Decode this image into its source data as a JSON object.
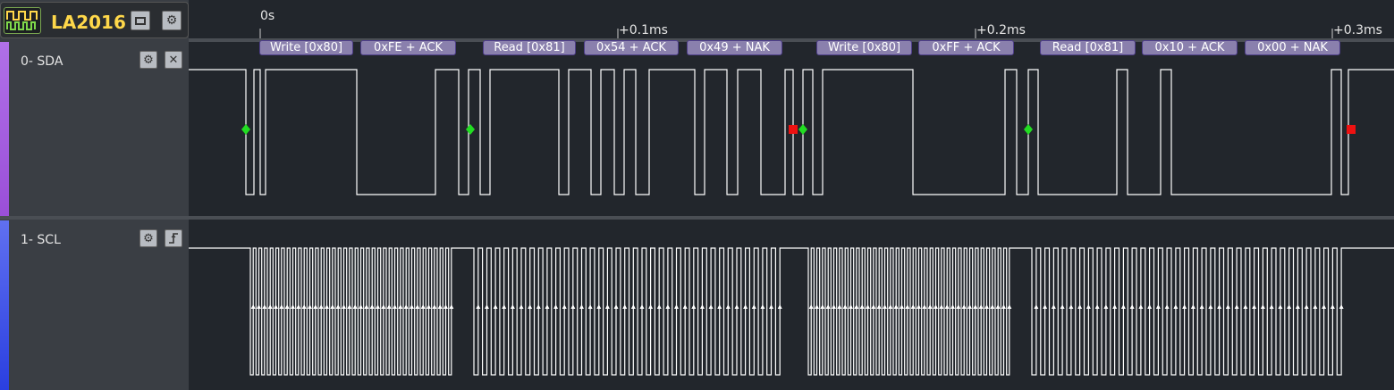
{
  "device": {
    "name": "LA2016",
    "logo_icon": "waveform-logo-icon"
  },
  "channels": [
    {
      "label": "0- SDA",
      "stripe_color": "#9a4fd8",
      "buttons": [
        "gear-icon",
        "close-icon"
      ]
    },
    {
      "label": "1- SCL",
      "stripe_color": "#2a3fe0",
      "buttons": [
        "gear-icon",
        "edge-trigger-icon"
      ]
    }
  ],
  "timeline": {
    "ticks": [
      "0s",
      "+0.1ms",
      "+0.2ms",
      "+0.3ms"
    ]
  },
  "annotations": [
    "Write [0x80]",
    "0xFE + ACK",
    "Read [0x81]",
    "0x54 + ACK",
    "0x49 + NAK",
    "Write [0x80]",
    "0xFF + ACK",
    "Read [0x81]",
    "0x10 + ACK",
    "0x00 + NAK"
  ],
  "colors": {
    "background": "#22262c",
    "panel": "#3a3e44",
    "trace": "#ffffff",
    "start_marker": "#22dd22",
    "stop_marker": "#ee1111",
    "annotation_fill": "#8a80ad"
  }
}
